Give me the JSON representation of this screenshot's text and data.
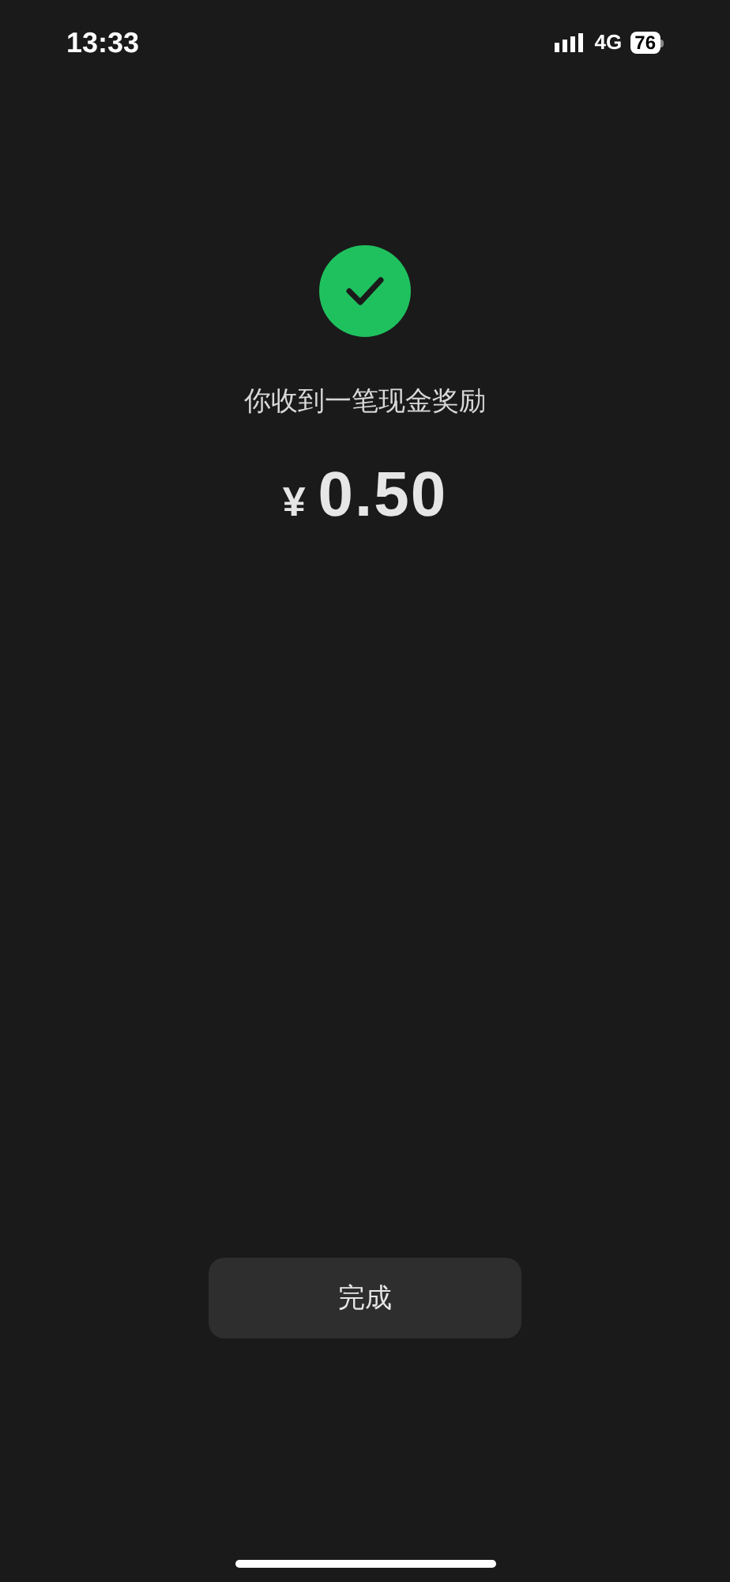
{
  "status_bar": {
    "time": "13:33",
    "network": "4G",
    "battery": "76"
  },
  "result": {
    "message": "你收到一笔现金奖励",
    "currency": "¥",
    "amount": "0.50"
  },
  "done_button": {
    "label": "完成"
  }
}
